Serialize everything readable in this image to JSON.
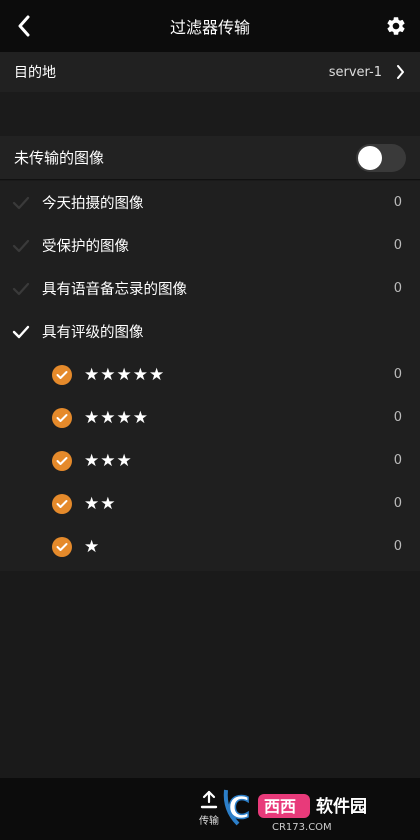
{
  "header": {
    "title": "过滤器传输"
  },
  "destination": {
    "label": "目的地",
    "value": "server-1"
  },
  "untransferred": {
    "label": "未传输的图像",
    "enabled": false
  },
  "filters": [
    {
      "label": "今天拍摄的图像",
      "count": "0",
      "checked": false
    },
    {
      "label": "受保护的图像",
      "count": "0",
      "checked": false
    },
    {
      "label": "具有语音备忘录的图像",
      "count": "0",
      "checked": false
    },
    {
      "label": "具有评级的图像",
      "count": "",
      "checked": true
    }
  ],
  "ratings": [
    {
      "stars": "★★★★★",
      "count": "0"
    },
    {
      "stars": "★★★★",
      "count": "0"
    },
    {
      "stars": "★★★",
      "count": "0"
    },
    {
      "stars": "★★",
      "count": "0"
    },
    {
      "stars": "★",
      "count": "0"
    }
  ],
  "footer": {
    "transfer_label": "传输",
    "watermark_text": "软件园",
    "watermark_sub": "CR173.COM"
  },
  "colors": {
    "accent": "#e58a2b",
    "background": "#1a1a1a",
    "header": "#0c0c0c"
  },
  "icons": {
    "back": "chevron-left-icon",
    "settings": "gear-icon",
    "upload": "upload-icon"
  }
}
